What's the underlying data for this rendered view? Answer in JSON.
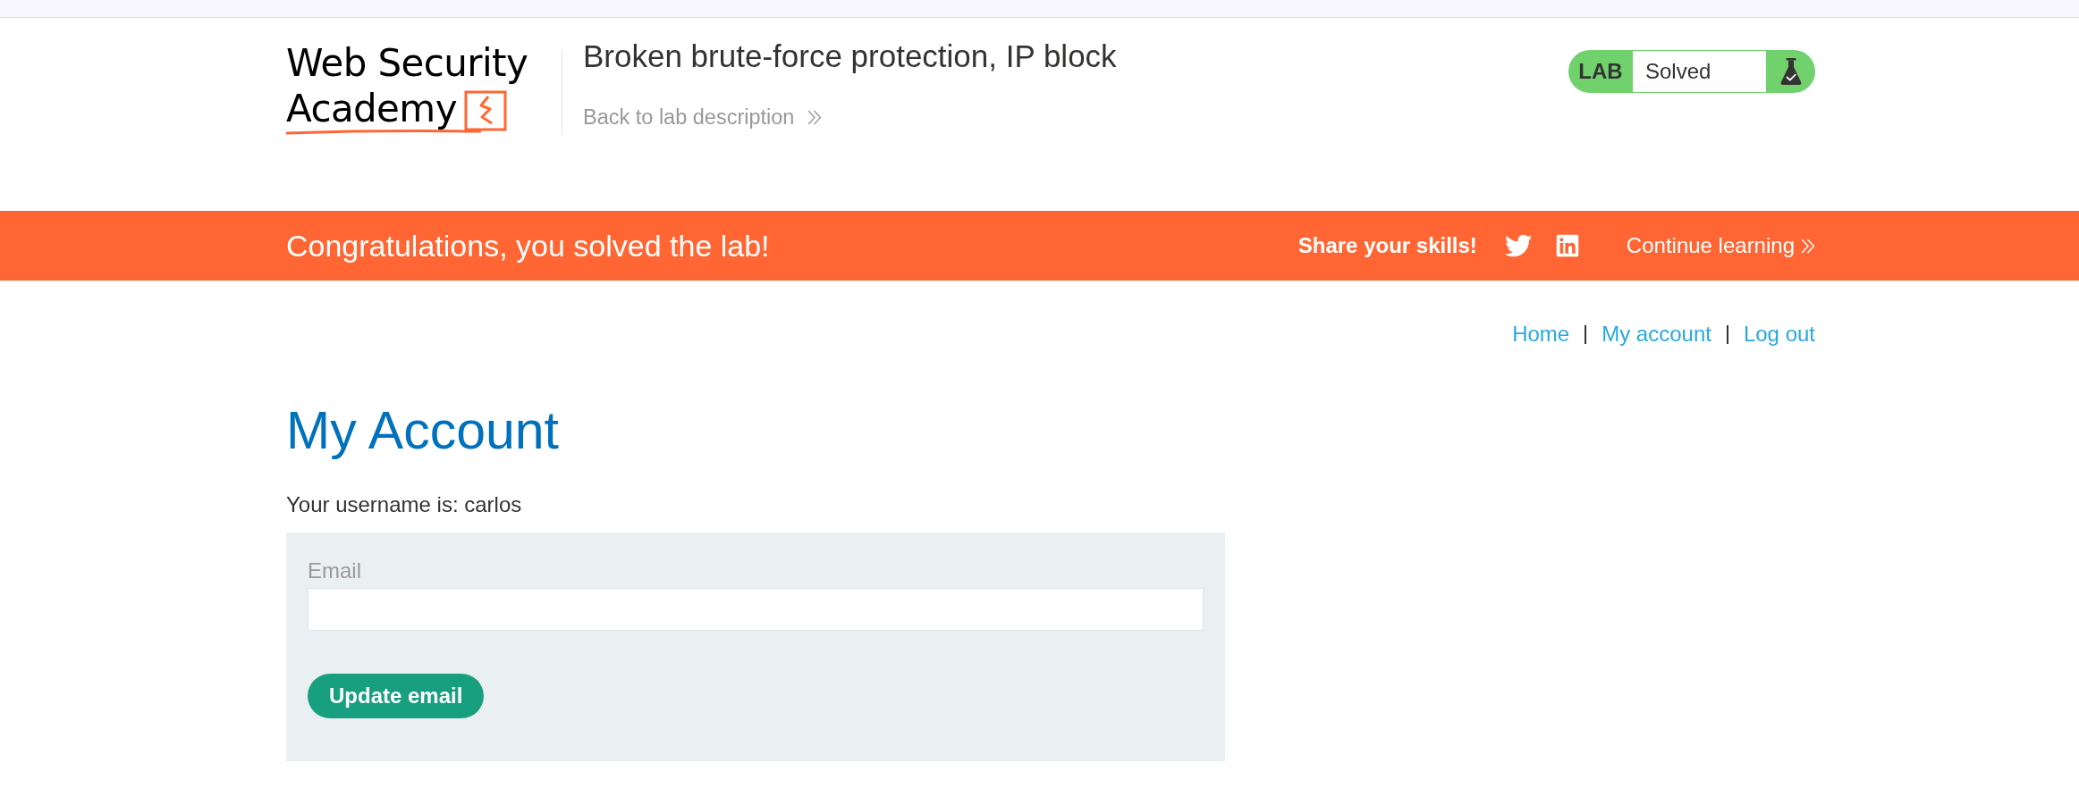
{
  "header": {
    "logo": {
      "line_1": "Web Security",
      "line_2": "Academy"
    },
    "title": "Broken brute-force protection, IP block",
    "back_link": "Back to lab description",
    "lab_status": {
      "label": "LAB",
      "status": "Solved",
      "solved": true
    }
  },
  "banner": {
    "message": "Congratulations, you solved the lab!",
    "share_label": "Share your skills!",
    "continue_link": "Continue learning"
  },
  "nav": {
    "links": [
      "Home",
      "My account",
      "Log out"
    ]
  },
  "account": {
    "heading": "My Account",
    "username_text": "Your username is: carlos"
  },
  "email_form": {
    "label": "Email",
    "button": "Update email"
  }
}
